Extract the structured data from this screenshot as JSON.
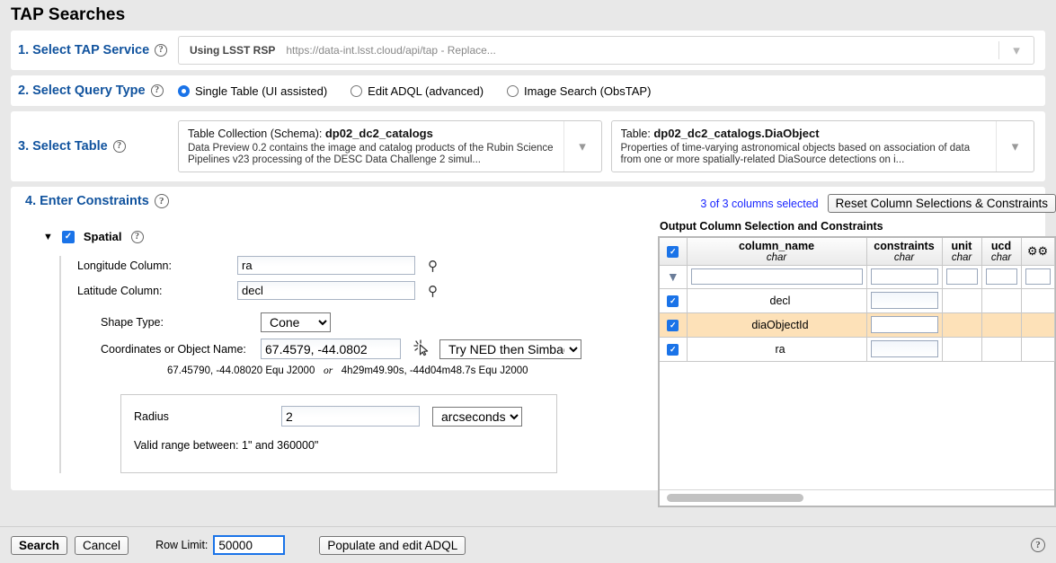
{
  "page_title": "TAP Searches",
  "steps": {
    "service": {
      "label": "1. Select TAP Service",
      "using": "Using LSST RSP",
      "url": "https://data-int.lsst.cloud/api/tap - Replace...",
      "chevron": "chevron-down-icon"
    },
    "query_type": {
      "label": "2. Select Query Type",
      "options": [
        {
          "label": "Single Table (UI assisted)",
          "selected": true
        },
        {
          "label": "Edit ADQL (advanced)",
          "selected": false
        },
        {
          "label": "Image Search (ObsTAP)",
          "selected": false
        }
      ]
    },
    "select_table": {
      "label": "3. Select Table",
      "schema": {
        "prefix": "Table Collection (Schema):",
        "value": "dp02_dc2_catalogs",
        "description": "Data Preview 0.2 contains the image and catalog products of the Rubin Science Pipelines v23 processing of the DESC Data Challenge 2 simul..."
      },
      "table": {
        "prefix": "Table:",
        "value": "dp02_dc2_catalogs.DiaObject",
        "description": "Properties of time-varying astronomical objects based on association of data from one or more spatially-related DiaSource detections on i..."
      }
    },
    "constraints": {
      "label": "4. Enter Constraints",
      "spatial": {
        "title": "Spatial",
        "checked": true,
        "collapse_glyph": "▼",
        "longitude_label": "Longitude Column:",
        "longitude_value": "ra",
        "latitude_label": "Latitude Column:",
        "latitude_value": "decl",
        "shape_label": "Shape Type:",
        "shape_value": "Cone",
        "coords_label": "Coordinates or Object Name:",
        "coords_value": "67.4579, -44.0802",
        "resolver_value": "Try NED then Simbad",
        "hint_deg": "67.45790, -44.08020  Equ J2000",
        "hint_or": "or",
        "hint_sex": "4h29m49.90s, -44d04m48.7s  Equ J2000",
        "radius_label": "Radius",
        "radius_value": "2",
        "radius_unit": "arcseconds",
        "radius_note": "Valid range between: 1\" and 360000\""
      }
    }
  },
  "output_columns": {
    "selected_text": "3 of 3 columns selected",
    "reset_button": "Reset Column Selections & Constraints",
    "caption": "Output Column Selection and Constraints",
    "headers": [
      {
        "name": "column_name",
        "type": "char"
      },
      {
        "name": "constraints",
        "type": "char"
      },
      {
        "name": "unit",
        "type": "char"
      },
      {
        "name": "ucd",
        "type": "char"
      }
    ],
    "header_all_checked": true,
    "gear_icon": "gear-icon",
    "filter_icon": "filter-icon",
    "filter_values": {
      "column_name": "",
      "constraints": "",
      "unit": "",
      "ucd": "",
      "extra": ""
    },
    "rows": [
      {
        "checked": true,
        "column_name": "decl",
        "constraints": "",
        "unit": "",
        "ucd": "",
        "highlighted": false
      },
      {
        "checked": true,
        "column_name": "diaObjectId",
        "constraints": "",
        "unit": "",
        "ucd": "",
        "highlighted": true
      },
      {
        "checked": true,
        "column_name": "ra",
        "constraints": "",
        "unit": "",
        "ucd": "",
        "highlighted": false
      }
    ]
  },
  "bottom_bar": {
    "search": "Search",
    "cancel": "Cancel",
    "row_limit_label": "Row Limit:",
    "row_limit_value": "50000",
    "adql_button": "Populate and edit ADQL",
    "help_icon": "help-circle-icon"
  },
  "colors": {
    "step_label": "#11539e",
    "link": "#1a26ff",
    "accent": "#1a73e8",
    "row_highlight": "#fde1b8",
    "page_bg": "#e8e8e8"
  }
}
